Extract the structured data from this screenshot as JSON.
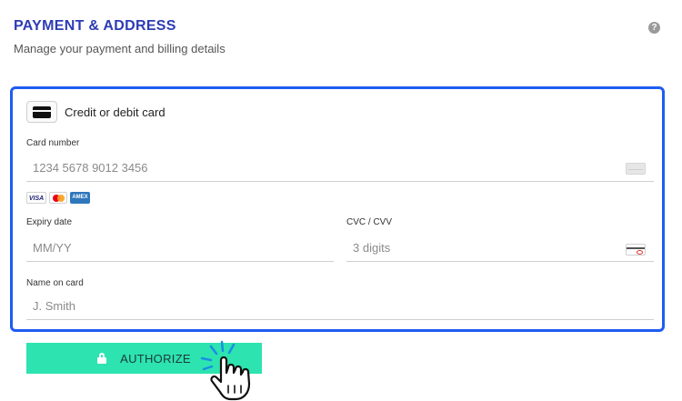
{
  "header": {
    "title": "PAYMENT & ADDRESS",
    "subtitle": "Manage your payment and billing details",
    "help_icon": "?"
  },
  "payment_method": {
    "label": "Credit or debit card",
    "icon": "credit-card-icon"
  },
  "form": {
    "card_number": {
      "label": "Card number",
      "placeholder": "1234 5678 9012 3456"
    },
    "card_brands": [
      "VISA",
      "mastercard",
      "AMEX"
    ],
    "expiry": {
      "label": "Expiry date",
      "placeholder": "MM/YY"
    },
    "cvc": {
      "label": "CVC / CVV",
      "placeholder": "3 digits"
    },
    "name": {
      "label": "Name on card",
      "placeholder": "J. Smith"
    }
  },
  "authorize_button": {
    "label": "AUTHORIZE",
    "icon": "lock-icon"
  },
  "colors": {
    "title": "#2d3bb5",
    "focus_border": "#1f5cf0",
    "button_bg": "#2de3b0",
    "cursor_accent": "#1a8fe3"
  }
}
